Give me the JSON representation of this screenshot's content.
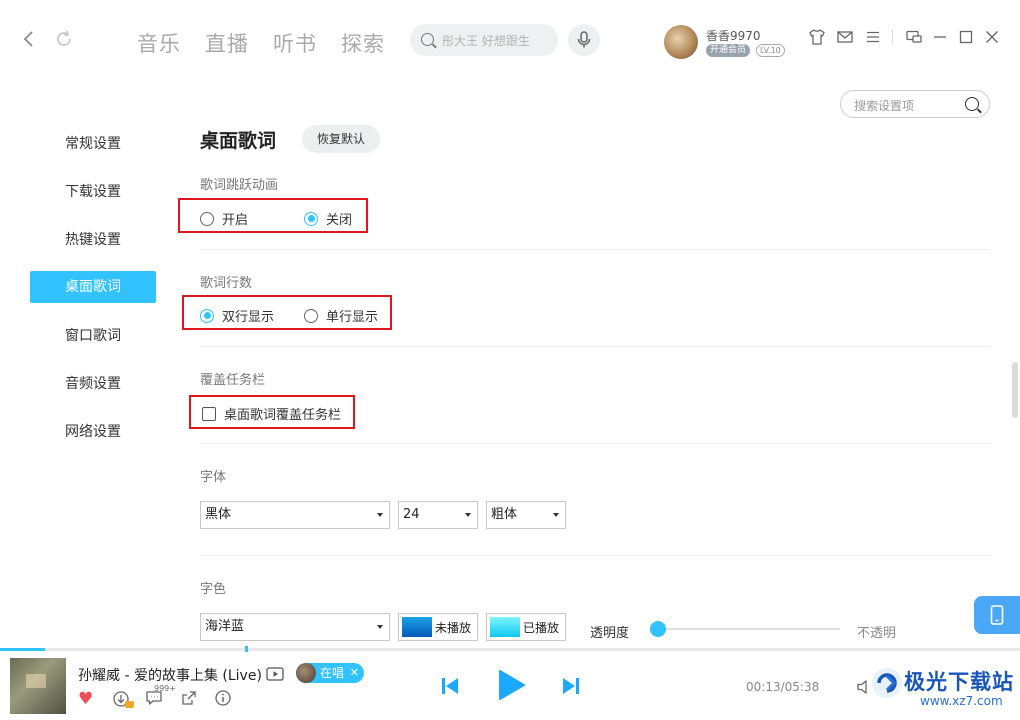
{
  "header": {
    "tabs": [
      "音乐",
      "直播",
      "听书",
      "探索"
    ],
    "search_placeholder": "彤大王 好想跟生",
    "username": "香香9970",
    "vip_badge": "开通会员",
    "level_badge": "LV.10"
  },
  "settings_search": {
    "placeholder": "搜索设置项"
  },
  "sidebar": {
    "items": [
      {
        "label": "常规设置",
        "active": false
      },
      {
        "label": "下载设置",
        "active": false
      },
      {
        "label": "热键设置",
        "active": false
      },
      {
        "label": "桌面歌词",
        "active": true
      },
      {
        "label": "窗口歌词",
        "active": false
      },
      {
        "label": "音频设置",
        "active": false
      },
      {
        "label": "网络设置",
        "active": false
      }
    ]
  },
  "main": {
    "title": "桌面歌词",
    "restore_button": "恢复默认",
    "jump_animation": {
      "label": "歌词跳跃动画",
      "options": [
        "开启",
        "关闭"
      ],
      "selected": "关闭"
    },
    "line_count": {
      "label": "歌词行数",
      "options": [
        "双行显示",
        "单行显示"
      ],
      "selected": "双行显示"
    },
    "cover_taskbar": {
      "label": "覆盖任务栏",
      "checkbox": "桌面歌词覆盖任务栏",
      "checked": false
    },
    "font": {
      "label": "字体",
      "family": "黑体",
      "size": "24",
      "weight": "粗体"
    },
    "color": {
      "label": "字色",
      "scheme": "海洋蓝",
      "unplayed": "未播放",
      "played": "已播放",
      "opacity_label": "透明度",
      "opaque_label": "不透明",
      "opacity_value": 0
    }
  },
  "player": {
    "song": "孙耀威 - 爱的故事上集 (Live)",
    "live_tag": "在唱",
    "comment_count": "999+",
    "time": "00:13/05:38"
  },
  "watermark": {
    "title": "极光下载站",
    "url": "www.xz7.com"
  },
  "colors": {
    "accent": "#31c2ff",
    "highlight_box": "#e0161e",
    "heart": "#ef4e59"
  }
}
